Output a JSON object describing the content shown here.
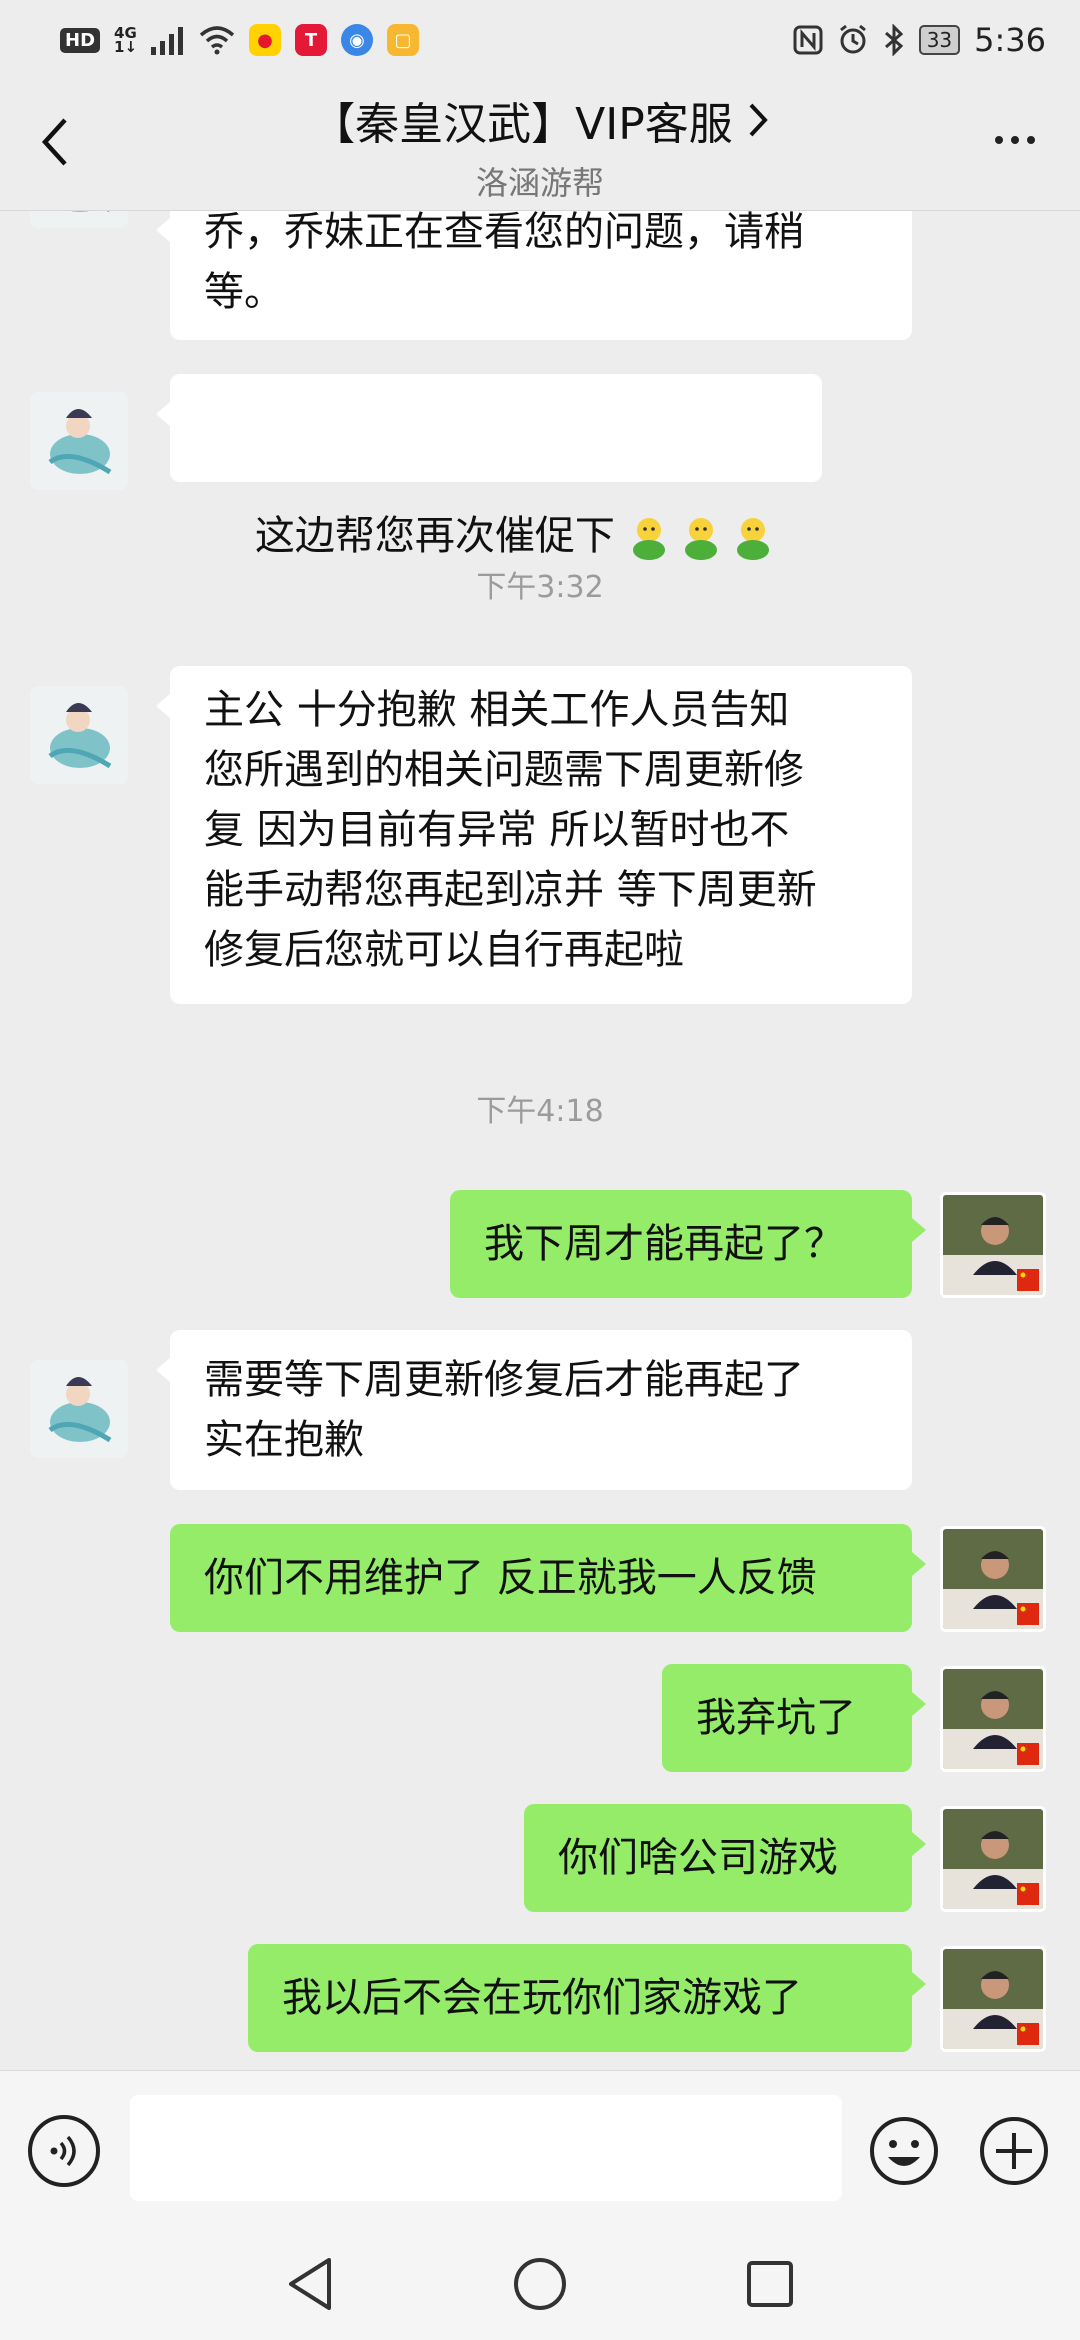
{
  "status_bar": {
    "hd": "HD",
    "network_top": "4G",
    "network_bottom": "1↓",
    "battery": "33",
    "time": "5:36",
    "app_icons": [
      "weibo-icon",
      "tesla-icon",
      "browser-icon",
      "notes-icon"
    ]
  },
  "header": {
    "title": "【秦皇汉武】VIP客服",
    "subtitle": "洛涵游帮"
  },
  "messages": [
    {
      "side": "in",
      "text": "乔，乔妹正在查看您的问题，请稍\n等。"
    },
    {
      "side": "in",
      "text": "这边帮您再次催促下",
      "emoji_count": 3
    },
    {
      "type": "time",
      "text": "下午3:32"
    },
    {
      "side": "in",
      "text": "主公 十分抱歉 相关工作人员告知\n您所遇到的相关问题需下周更新修\n复 因为目前有异常 所以暂时也不\n能手动帮您再起到凉并 等下周更新\n修复后您就可以自行再起啦"
    },
    {
      "type": "time",
      "text": "下午4:18"
    },
    {
      "side": "out",
      "text": "我下周才能再起了？"
    },
    {
      "side": "in",
      "text": "需要等下周更新修复后才能再起了\n实在抱歉"
    },
    {
      "side": "out",
      "text": "你们不用维护了 反正就我一人反馈"
    },
    {
      "side": "out",
      "text": "我弃坑了"
    },
    {
      "side": "out",
      "text": "你们啥公司游戏"
    },
    {
      "side": "out",
      "text": "我以后不会在玩你们家游戏了"
    }
  ],
  "input": {
    "placeholder": "",
    "value": ""
  },
  "colors": {
    "outgoing_bubble": "#95ec69",
    "incoming_bubble": "#ffffff",
    "background": "#ededed"
  }
}
